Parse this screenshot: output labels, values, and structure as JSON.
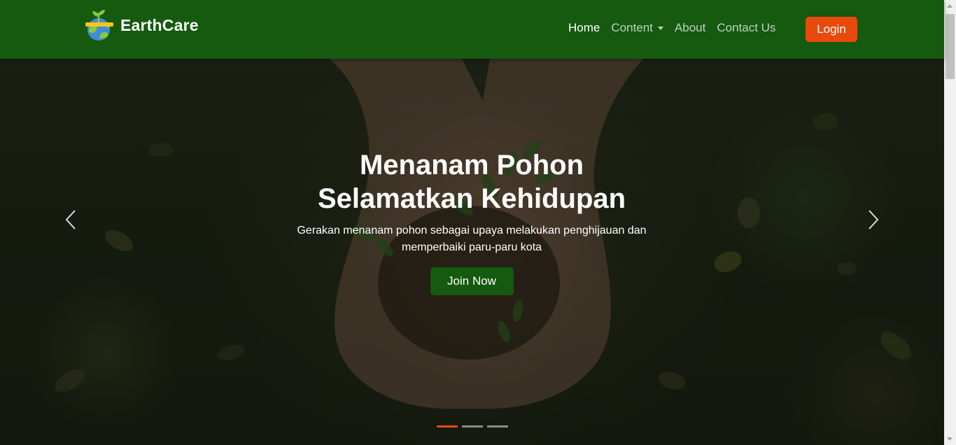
{
  "brand": {
    "name": "EarthCare",
    "logo_icon": "earth-plant-icon"
  },
  "nav": {
    "items": [
      {
        "label": "Home",
        "active": true
      },
      {
        "label": "Content",
        "dropdown": true
      },
      {
        "label": "About"
      },
      {
        "label": "Contact Us"
      }
    ],
    "login_label": "Login"
  },
  "hero": {
    "title_line1": "Menanam Pohon",
    "title_line2": "Selamatkan Kehidupan",
    "description": "Gerakan menanam pohon sebagai upaya melakukan penghijauan dan memperbaiki paru-paru kota",
    "cta_label": "Join Now",
    "prev_icon": "chevron-left-icon",
    "next_icon": "chevron-right-icon",
    "slides_count": 3,
    "active_slide": 1
  },
  "colors": {
    "navbar": "#155a0f",
    "login": "#e84a0c",
    "cta": "#155a0f",
    "indicator_active": "#e84a0c"
  }
}
